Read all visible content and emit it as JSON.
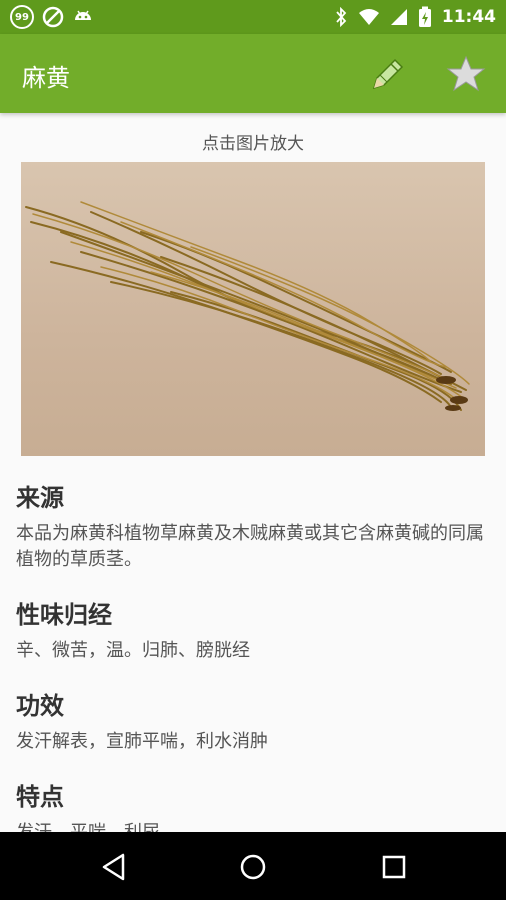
{
  "status_bar": {
    "badge_text": "99",
    "time": "11:44",
    "icons": [
      "notification-99-icon",
      "blocked-icon",
      "android-icon",
      "bluetooth-icon",
      "wifi-icon",
      "signal-icon",
      "battery-charging-icon"
    ]
  },
  "app_bar": {
    "title": "麻黄",
    "actions": [
      "edit-icon",
      "star-icon"
    ],
    "color": "#72ad2a"
  },
  "image": {
    "caption": "点击图片放大",
    "subject": "herb-photo"
  },
  "sections": [
    {
      "heading": "来源",
      "text": "本品为麻黄科植物草麻黄及木贼麻黄或其它含麻黄碱的同属植物的草质茎。"
    },
    {
      "heading": "性味归经",
      "text": "辛、微苦，温。归肺、膀胱经"
    },
    {
      "heading": "功效",
      "text": "发汗解表，宣肺平喘，利水消肿"
    },
    {
      "heading": "特点",
      "text": "发汗，平喘，利尿"
    }
  ],
  "nav_bar": [
    "back-icon",
    "home-icon",
    "recents-icon"
  ]
}
